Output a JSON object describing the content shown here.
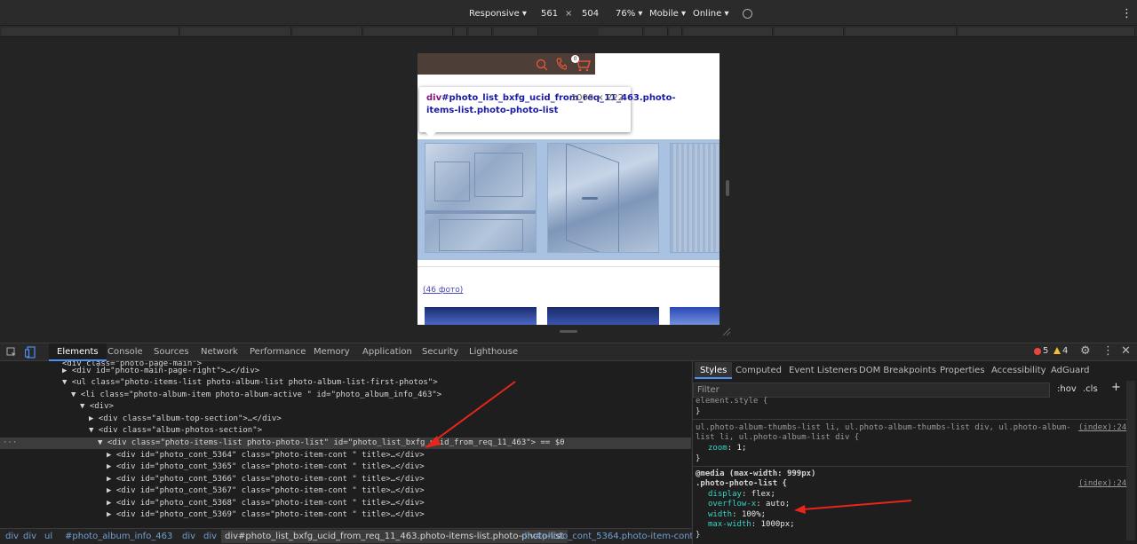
{
  "device_toolbar": {
    "mode": "Responsive",
    "width": "561",
    "times": "×",
    "height": "504",
    "zoom": "76%",
    "device_type": "Mobile",
    "throttle": "Online"
  },
  "viewport": {
    "cart_badge": "0",
    "photo_count_link": "(46 фото)"
  },
  "tooltip": {
    "tag": "div",
    "selector": "#photo_list_bxfg_ucid_from_req_11_463.photo-items-list.photo-photo-list",
    "size": "1000 × 222"
  },
  "devtools_tabs": [
    "Elements",
    "Console",
    "Sources",
    "Network",
    "Performance",
    "Memory",
    "Application",
    "Security",
    "Lighthouse"
  ],
  "status": {
    "errors": "5",
    "warnings": "4"
  },
  "dom_lines": [
    {
      "indent": 70,
      "text": "<div class=\"photo-page-main\">"
    },
    {
      "indent": 70,
      "text": "▶ <div id=\"photo-main-page-right\">…</div>"
    },
    {
      "indent": 70,
      "text": "▼ <ul class=\"photo-items-list photo-album-list photo-album-list-first-photos\">"
    },
    {
      "indent": 80,
      "text": "▼ <li class=\"photo-album-item photo-album-active \" id=\"photo_album_info_463\">"
    },
    {
      "indent": 90,
      "text": "▼ <div>"
    },
    {
      "indent": 100,
      "text": "▶ <div class=\"album-top-section\">…</div>"
    },
    {
      "indent": 100,
      "text": "▼ <div class=\"album-photos-section\">"
    },
    {
      "indent": 110,
      "text": "▼ <div class=\"photo-items-list photo-photo-list\" id=\"photo_list_bxfg_ucid_from_req_11_463\"> == $0"
    },
    {
      "indent": 120,
      "text": "▶ <div id=\"photo_cont_5364\" class=\"photo-item-cont \" title>…</div>"
    },
    {
      "indent": 120,
      "text": "▶ <div id=\"photo_cont_5365\" class=\"photo-item-cont \" title>…</div>"
    },
    {
      "indent": 120,
      "text": "▶ <div id=\"photo_cont_5366\" class=\"photo-item-cont \" title>…</div>"
    },
    {
      "indent": 120,
      "text": "▶ <div id=\"photo_cont_5367\" class=\"photo-item-cont \" title>…</div>"
    },
    {
      "indent": 120,
      "text": "▶ <div id=\"photo_cont_5368\" class=\"photo-item-cont \" title>…</div>"
    },
    {
      "indent": 120,
      "text": "▶ <div id=\"photo_cont_5369\" class=\"photo-item-cont \" title>…</div>"
    }
  ],
  "breadcrumbs": [
    "div",
    "div",
    "ul",
    "#photo_album_info_463",
    "div",
    "div",
    "div#photo_list_bxfg_ucid_from_req_11_463.photo-items-list.photo-photo-list",
    "div#photo_cont_5364.photo-item-cont"
  ],
  "styles_tabs": [
    "Styles",
    "Computed",
    "Event Listeners",
    "DOM Breakpoints",
    "Properties",
    "Accessibility",
    "AdGuard"
  ],
  "styles": {
    "filter_placeholder": "Filter",
    "hov": ":hov",
    "cls": ".cls",
    "add": "+",
    "element_style": "element.style {",
    "close_brace": "}",
    "rule1_selector_a": "ul.photo-album-thumbs-list li, ul.photo-album-thumbs-list div, ul.photo-album-",
    "rule1_selector_b": "list li, ul.photo-album-list div {",
    "rule1_source": "(index):24",
    "rule1_prop": "zoom",
    "rule1_val": "1;",
    "media": "@media (max-width: 999px)",
    "rule2_selector": ".photo-photo-list {",
    "rule2_source": "(index):24",
    "rule2_props": [
      {
        "name": "display",
        "value": "flex;"
      },
      {
        "name": "overflow-x",
        "value": "auto;"
      },
      {
        "name": "width",
        "value": "100%;"
      },
      {
        "name": "max-width",
        "value": "1000px;"
      }
    ]
  },
  "colors": {
    "highlight": "#a9c2e1",
    "accent": "#4c8ff7",
    "error": "#e8453c",
    "warning": "#f2c037"
  }
}
